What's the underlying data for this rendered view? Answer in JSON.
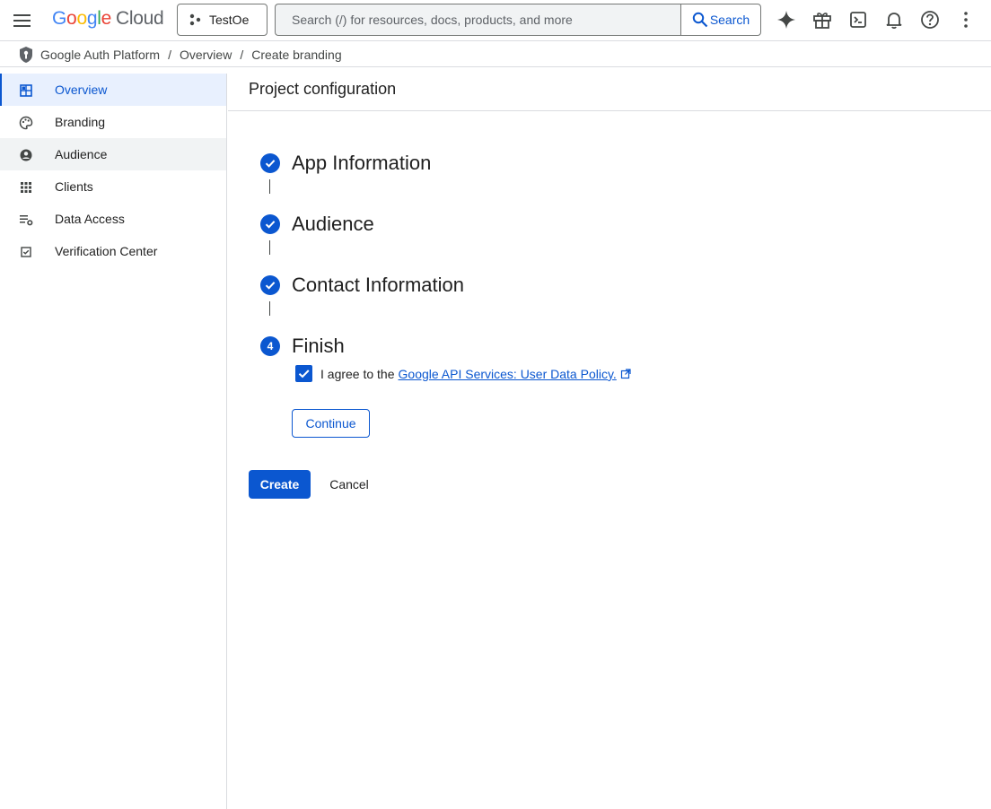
{
  "header": {
    "logo_google": "Google",
    "logo_cloud": "Cloud",
    "project_name": "TestOe",
    "search_placeholder": "Search (/) for resources, docs, products, and more",
    "search_button_label": "Search",
    "icons": [
      "menu-icon",
      "gemini-sparkle-icon",
      "gift-icon",
      "cloud-shell-icon",
      "notifications-icon",
      "help-icon",
      "more-vert-icon"
    ]
  },
  "breadcrumb": {
    "items": [
      "Google Auth Platform",
      "Overview",
      "Create branding"
    ],
    "separator": "/"
  },
  "sidebar": {
    "items": [
      {
        "label": "Overview",
        "icon": "dashboard-icon",
        "state": "active"
      },
      {
        "label": "Branding",
        "icon": "palette-icon",
        "state": "normal"
      },
      {
        "label": "Audience",
        "icon": "account-circle-icon",
        "state": "hover"
      },
      {
        "label": "Clients",
        "icon": "apps-grid-icon",
        "state": "normal"
      },
      {
        "label": "Data Access",
        "icon": "list-settings-icon",
        "state": "normal"
      },
      {
        "label": "Verification Center",
        "icon": "check-box-icon",
        "state": "normal"
      }
    ]
  },
  "main": {
    "title": "Project configuration",
    "steps": [
      {
        "label": "App Information",
        "status": "complete"
      },
      {
        "label": "Audience",
        "status": "complete"
      },
      {
        "label": "Contact Information",
        "status": "complete"
      },
      {
        "label": "Finish",
        "status": "current",
        "number": "4"
      }
    ],
    "agree_prefix": "I agree to the",
    "agree_link": "Google API Services: User Data Policy.",
    "agree_checked": true,
    "continue_label": "Continue",
    "create_label": "Create",
    "cancel_label": "Cancel"
  },
  "colors": {
    "accent": "#0b57d0",
    "active_nav_bg": "#e8f0fe",
    "border": "#dadce0"
  }
}
